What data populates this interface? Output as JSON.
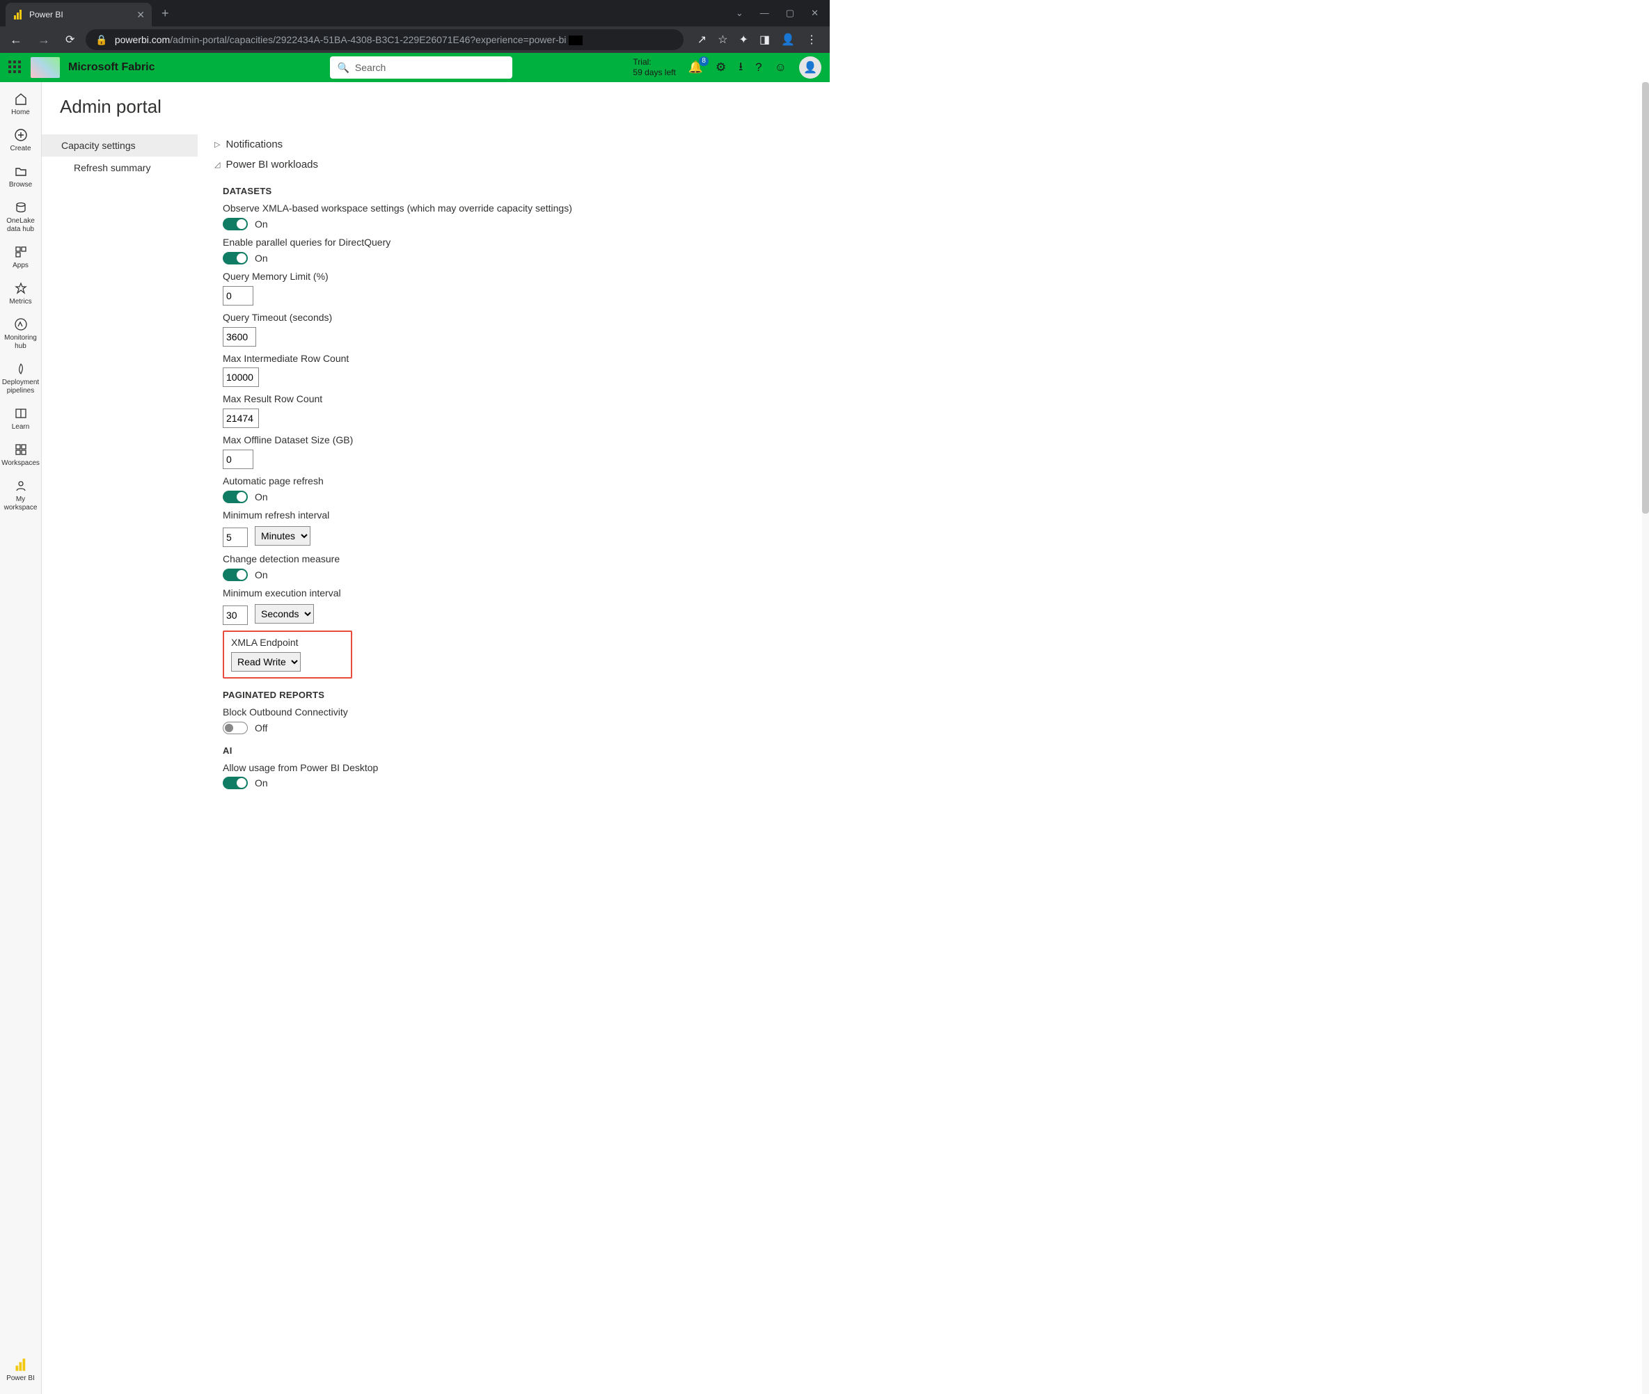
{
  "browser": {
    "tab_title": "Power BI",
    "url_domain": "powerbi.com",
    "url_path": "/admin-portal/capacities/2922434A-51BA-4308-B3C1-229E26071E46?experience=power-bi"
  },
  "header": {
    "brand": "Microsoft Fabric",
    "search_placeholder": "Search",
    "trial_label": "Trial:",
    "trial_days": "59 days left",
    "notification_count": "8"
  },
  "rail": {
    "home": "Home",
    "create": "Create",
    "browse": "Browse",
    "onelake": "OneLake data hub",
    "apps": "Apps",
    "metrics": "Metrics",
    "monitoring": "Monitoring hub",
    "deployment": "Deployment pipelines",
    "learn": "Learn",
    "workspaces": "Workspaces",
    "my_workspace": "My workspace",
    "powerbi": "Power BI"
  },
  "page": {
    "title": "Admin portal",
    "menu_capacity": "Capacity settings",
    "menu_refresh": "Refresh summary"
  },
  "sections": {
    "notifications": "Notifications",
    "workloads": "Power BI workloads"
  },
  "datasets": {
    "title": "DATASETS",
    "observe_xmla": "Observe XMLA-based workspace settings (which may override capacity settings)",
    "parallel_dq": "Enable parallel queries for DirectQuery",
    "qmem": "Query Memory Limit (%)",
    "qmem_val": "0",
    "qtimeout": "Query Timeout (seconds)",
    "qtimeout_val": "3600",
    "max_inter": "Max Intermediate Row Count",
    "max_inter_val": "10000",
    "max_result": "Max Result Row Count",
    "max_result_val": "21474",
    "max_offline": "Max Offline Dataset Size (GB)",
    "max_offline_val": "0",
    "auto_refresh": "Automatic page refresh",
    "min_refresh": "Minimum refresh interval",
    "min_refresh_val": "5",
    "min_refresh_unit": "Minutes",
    "change_detect": "Change detection measure",
    "min_exec": "Minimum execution interval",
    "min_exec_val": "30",
    "min_exec_unit": "Seconds",
    "xmla": "XMLA Endpoint",
    "xmla_val": "Read Write",
    "on": "On",
    "off": "Off"
  },
  "paginated": {
    "title": "PAGINATED REPORTS",
    "block_outbound": "Block Outbound Connectivity"
  },
  "ai": {
    "title": "AI",
    "allow_desktop": "Allow usage from Power BI Desktop"
  }
}
